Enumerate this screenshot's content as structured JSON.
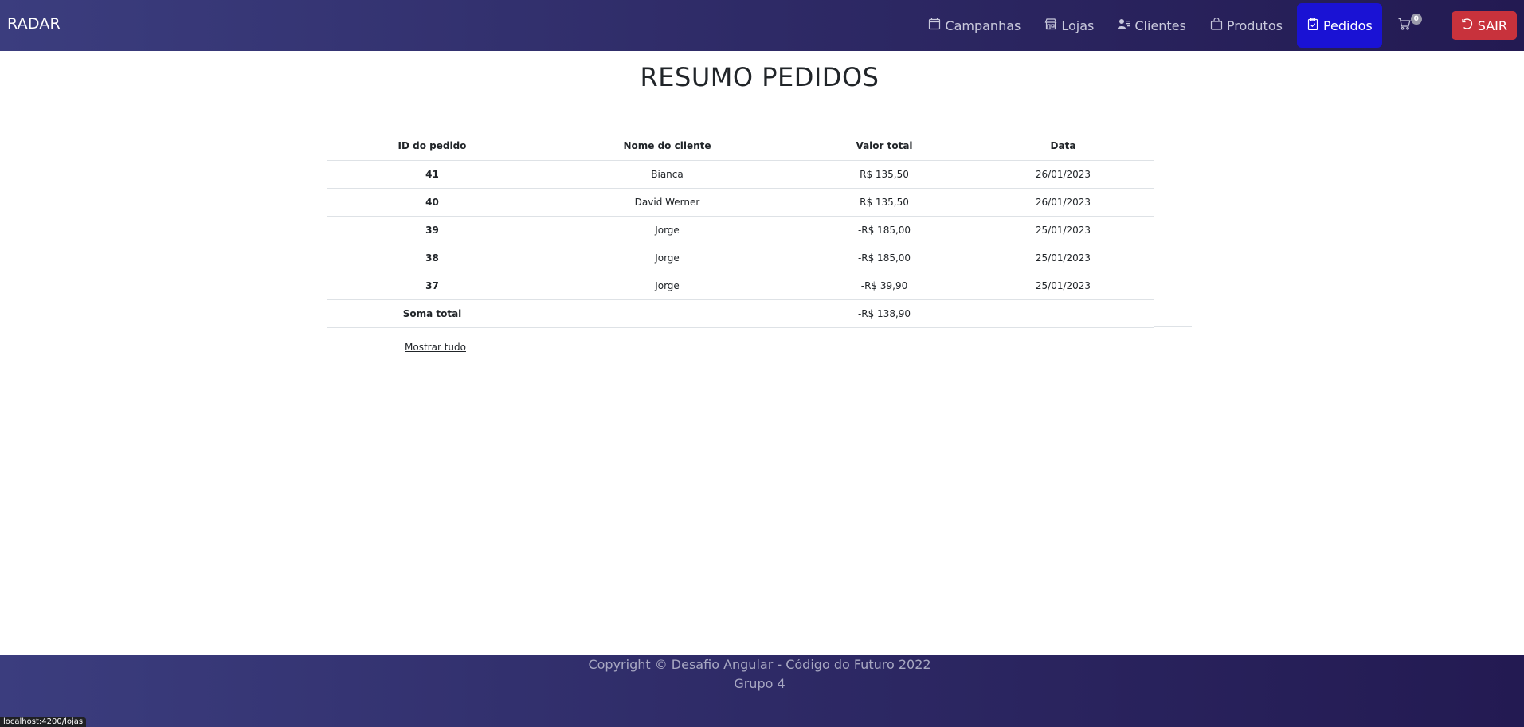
{
  "nav": {
    "brand": "RADAR",
    "items": [
      {
        "label": "Campanhas",
        "icon": "calendar-icon"
      },
      {
        "label": "Lojas",
        "icon": "shop-icon"
      },
      {
        "label": "Clientes",
        "icon": "person-lines-icon"
      },
      {
        "label": "Produtos",
        "icon": "bag-icon"
      },
      {
        "label": "Pedidos",
        "icon": "clipboard-icon",
        "active": true
      }
    ],
    "cart_count": "0",
    "logout_label": "SAIR"
  },
  "main": {
    "title": "RESUMO PEDIDOS",
    "columns": [
      "ID do pedido",
      "Nome do cliente",
      "Valor total",
      "Data"
    ],
    "rows": [
      {
        "id": "41",
        "client": "Bianca",
        "total": "R$ 135,50",
        "date": "26/01/2023"
      },
      {
        "id": "40",
        "client": "David Werner",
        "total": "R$ 135,50",
        "date": "26/01/2023"
      },
      {
        "id": "39",
        "client": "Jorge",
        "total": "-R$ 185,00",
        "date": "25/01/2023"
      },
      {
        "id": "38",
        "client": "Jorge",
        "total": "-R$ 185,00",
        "date": "25/01/2023"
      },
      {
        "id": "37",
        "client": "Jorge",
        "total": "-R$ 39,90",
        "date": "25/01/2023"
      }
    ],
    "total_label": "Soma total",
    "total_value": "-R$ 138,90",
    "show_all": "Mostrar tudo"
  },
  "footer": {
    "copyright": "Copyright © Desafio Angular - Código do Futuro 2022",
    "group": "Grupo 4"
  },
  "status_url": "localhost:4200/lojas"
}
